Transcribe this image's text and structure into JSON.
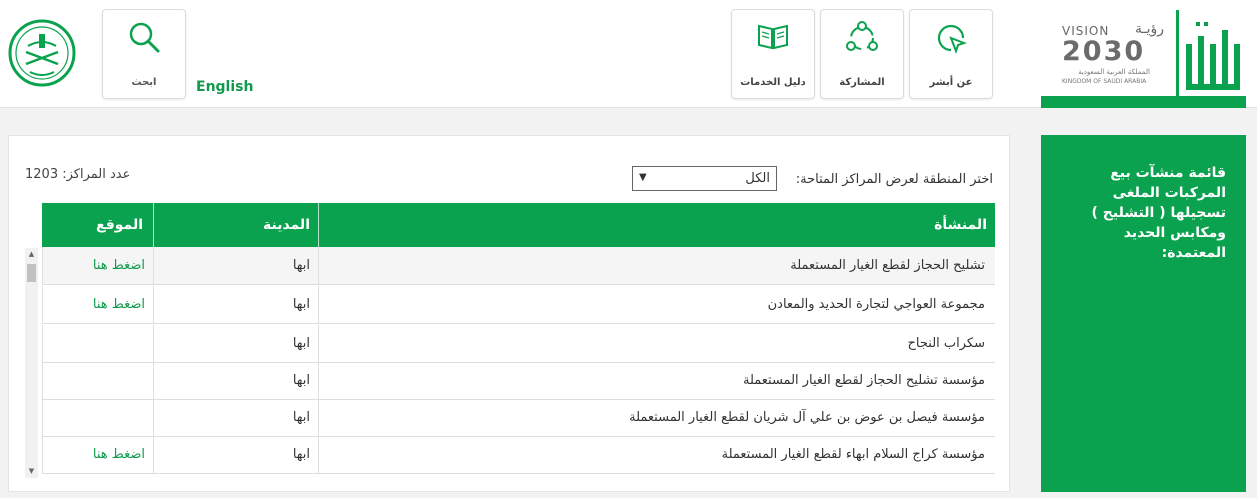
{
  "header": {
    "search_label": "ابحث",
    "english_label": "English",
    "nav": [
      {
        "label": "دليل الخدمات",
        "icon": "book-icon"
      },
      {
        "label": "المشاركة",
        "icon": "share-icon"
      },
      {
        "label": "عن أبشر",
        "icon": "cursor-icon"
      }
    ],
    "vision": {
      "word": "VISION",
      "arabic": "رؤيـة",
      "year": "2030",
      "kingdom_ar": "المملكة العربية السعودية",
      "kingdom_en": "KINGDOM OF SAUDI ARABIA"
    }
  },
  "sidebar": {
    "title": "قائمة منشآت بيع المركبات الملغى تسجيلها ( التشليح ) ومكابس الحديد المعتمدة:"
  },
  "filter": {
    "region_label": "اختر المنطقة لعرض المراكز المتاحة:",
    "region_value": "الكل",
    "count_label": "عدد المراكز: 1203"
  },
  "table": {
    "headers": {
      "name": "المنشأة",
      "city": "المدينة",
      "location": "الموقع"
    },
    "rows": [
      {
        "name": "تشليح الحجاز لقطع الغيار المستعملة",
        "city": "ابها",
        "location": "اضغط هنا"
      },
      {
        "name": "مجموعة العواجي لتجارة الحديد والمعادن",
        "city": "ابها",
        "location": "اضغط هنا"
      },
      {
        "name": "سكراب النجاح",
        "city": "ابها",
        "location": ""
      },
      {
        "name": "مؤسسة تشليح الحجاز لقطع الغيار المستعملة",
        "city": "ابها",
        "location": ""
      },
      {
        "name": "مؤسسة فيصل بن عوض بن علي آل شريان لقطع الغيار المستعملة",
        "city": "ابها",
        "location": ""
      },
      {
        "name": "مؤسسة كراج السلام ابهاء لقطع الغيار المستعملة",
        "city": "ابها",
        "location": "اضغط هنا"
      }
    ]
  },
  "colors": {
    "brand_green": "#0aa24f",
    "link_green": "#119a4d"
  }
}
